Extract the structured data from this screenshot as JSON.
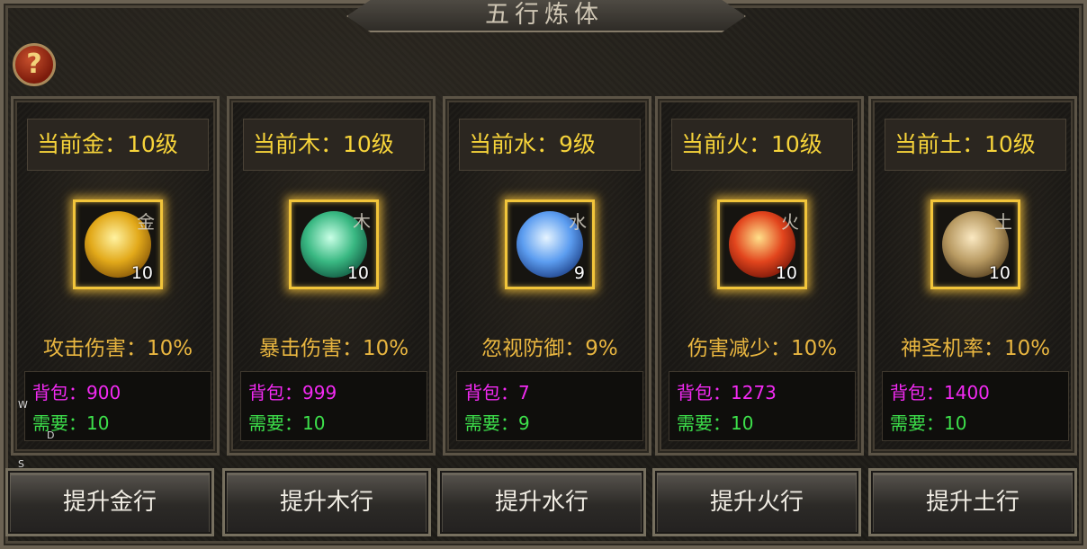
{
  "title": "五行炼体",
  "help_label": "?",
  "hotkeys": [
    "W",
    "D",
    "S"
  ],
  "elements": [
    {
      "level_text": "当前金：10级",
      "orb_char": "金",
      "orb_level": "10",
      "effect_text": "攻击伤害：10%",
      "bag_text": "背包：900",
      "need_text": "需要：10",
      "button_label": "提升金行",
      "orb_color": "#e2a91a"
    },
    {
      "level_text": "当前木：10级",
      "orb_char": "木",
      "orb_level": "10",
      "effect_text": "暴击伤害：10%",
      "bag_text": "背包：999",
      "need_text": "需要：10",
      "button_label": "提升木行",
      "orb_color": "#39b882"
    },
    {
      "level_text": "当前水：9级",
      "orb_char": "水",
      "orb_level": "9",
      "effect_text": "忽视防御：9%",
      "bag_text": "背包：7",
      "need_text": "需要：9",
      "button_label": "提升水行",
      "orb_color": "#5c9df0"
    },
    {
      "level_text": "当前火：10级",
      "orb_char": "火",
      "orb_level": "10",
      "effect_text": "伤害减少：10%",
      "bag_text": "背包：1273",
      "need_text": "需要：10",
      "button_label": "提升火行",
      "orb_color": "#e2451d"
    },
    {
      "level_text": "当前土：10级",
      "orb_char": "土",
      "orb_level": "10",
      "effect_text": "神圣机率：10%",
      "bag_text": "背包：1400",
      "need_text": "需要：10",
      "button_label": "提升土行",
      "orb_color": "#b89a62"
    }
  ]
}
